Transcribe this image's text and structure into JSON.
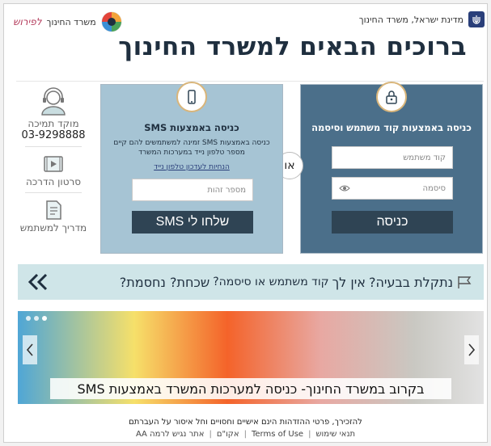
{
  "header": {
    "gov_title": "מדינת ישראל, משרד החינוך",
    "ministry_name": "משרד החינוך",
    "ministry_tag": "לפירוש",
    "welcome": "ברוכים הבאים למשרד החינוך"
  },
  "login_user": {
    "title": "כניסה באמצעות קוד משתמש וסיסמה",
    "username_placeholder": "קוד משתמש",
    "password_placeholder": "סיסמה",
    "submit_label": "כניסה"
  },
  "or_label": "או",
  "login_sms": {
    "title": "כניסה באמצעות SMS",
    "description": "כניסה באמצעות SMS זמינה למשתמשים להם קיים מספר טלפון נייד במערכות המשרד",
    "update_link": "הנחיות לעדכון טלפון נייד",
    "id_placeholder": "מספר זהות",
    "submit_label": "שלחו לי SMS"
  },
  "sidebar": {
    "support_label": "מוקד תמיכה",
    "support_phone": "03-9298888",
    "video_label": "סרטון הדרכה",
    "guide_label": "מדריך למשתמש"
  },
  "trouble": {
    "lead": "נתקלת בבעיה?",
    "middle_a": "אין לך",
    "middle_b": "קוד משתמש או סיסמה?",
    "tail": "שכחת? נחסמת?"
  },
  "banner": {
    "caption": "בקרוב במשרד החינוך- כניסה למערכות המשרד באמצעות SMS"
  },
  "footer": {
    "note": "להזכירך, פרטי ההזדהות הינם אישיים וחסויים וחל איסור על העברתם",
    "links": [
      "תנאי שימוש",
      "Terms of Use",
      "אקו\"ם",
      "אתר נגיש לרמה AA"
    ]
  },
  "colors": {
    "panel_dark": "#4b6f8a",
    "panel_light": "#a6c4d4",
    "button_dark": "#2f4454",
    "trouble_bg": "#cfe5e8"
  }
}
